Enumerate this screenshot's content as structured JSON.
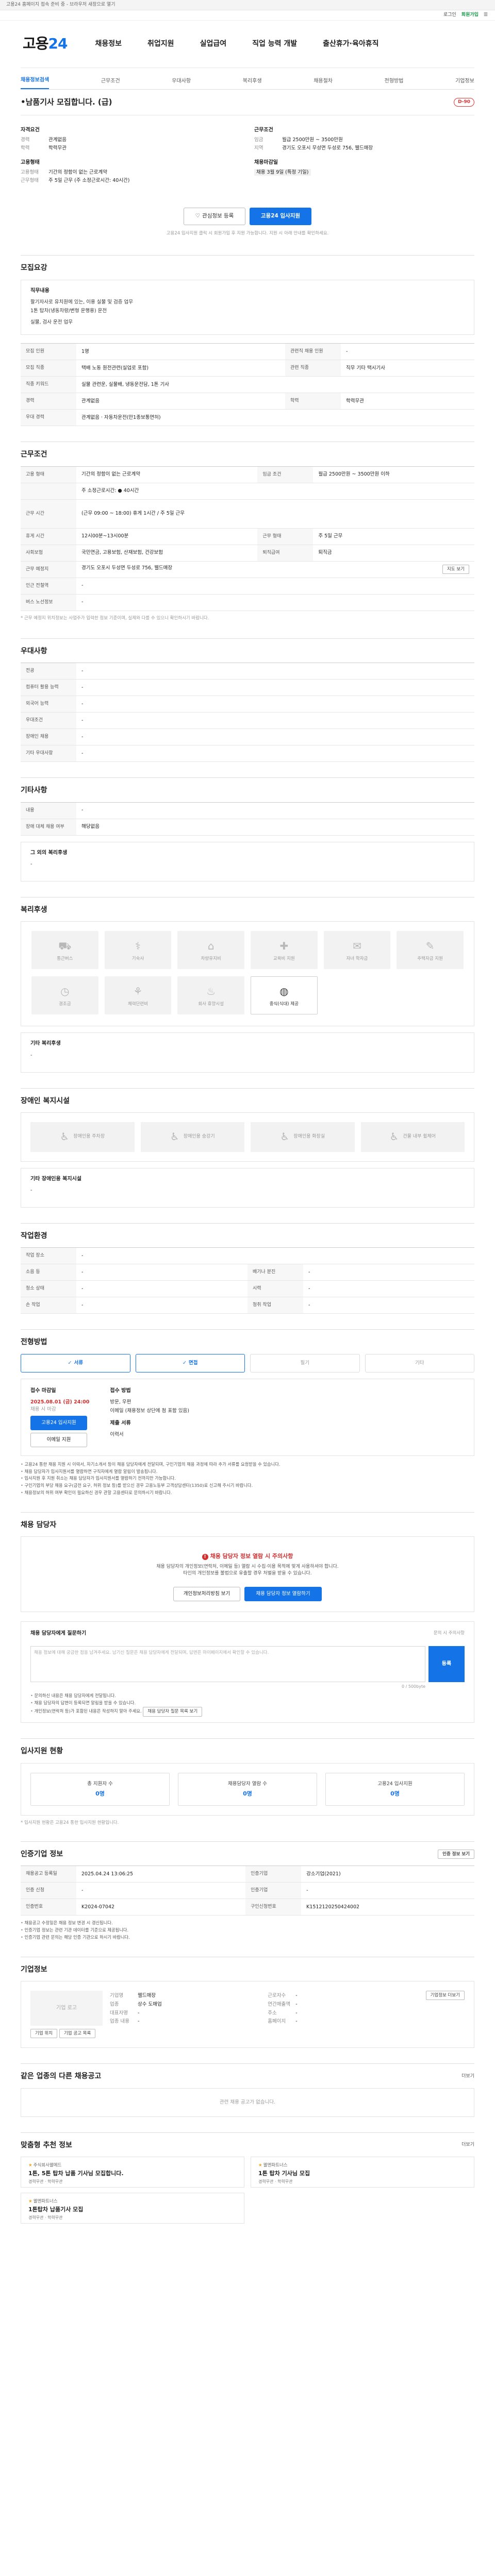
{
  "banner": {
    "text": "고용24 홈페이지 접속 준비 중 - 브라우저 새창으로 열기"
  },
  "util": {
    "login": "로그인",
    "join": "회원가입",
    "menu": "전체메뉴"
  },
  "header": {
    "logo_main": "고용",
    "logo_num": "24",
    "gnb": [
      "채용정보",
      "취업지원",
      "실업급여",
      "직업 능력 개발",
      "출산휴가·육아휴직"
    ]
  },
  "subtabs": [
    "채용정보검색",
    "근무조건",
    "우대사항",
    "복리후생",
    "채용절차",
    "전형방법",
    "기업정보"
  ],
  "job": {
    "title": "•남품기사 모집합니다. (급)",
    "dday": "D-90"
  },
  "summary": {
    "left_label": "자격요건",
    "left_rows": [
      {
        "k": "경력",
        "v": "관계없음"
      },
      {
        "k": "학력",
        "v": "학력무관"
      }
    ],
    "left_label2": "고용형태",
    "left_rows2": [
      {
        "k": "고용형태",
        "v": "기간의 정함이 없는 근로계약"
      },
      {
        "k": "근무형태",
        "v": "주 5일 근무 (주 소정근로시간: 40시간)"
      }
    ],
    "right_label": "근무조건",
    "right_rows": [
      {
        "k": "임금",
        "v": "월급 2500만원 ~ 3500만원"
      },
      {
        "k": "지역",
        "v": "경기도 오포시 무성면 두성로 756, 웰드매장"
      }
    ],
    "right_label2": "채용마감일",
    "right_rows2": [
      {
        "k": "",
        "v": "채용 3월 9일 (특정 기일)"
      }
    ]
  },
  "actions": {
    "scrap": "관심정보 등록",
    "apply": "고용24 입사지원"
  },
  "apply_note": "고용24 입사지원 클릭 시 회원가입 후 지원 가능합니다. 지원 시 아래 안내를 확인하세요.",
  "recruit": {
    "heading": "모집요강",
    "duty_label": "직무내용",
    "duty_lines": [
      "팔기자사로 유치원에 있는, 이용 실물 및 검증 업무",
      "1톤 탑차(냉동차량/변형 운행용) 운전",
      "실물, 검사 운전 업무"
    ],
    "rows": [
      {
        "k": "모집 인원",
        "v": "1명",
        "k2": "관련직 채용 인원",
        "v2": "-"
      },
      {
        "k": "모집 직종",
        "v": "택배 노동 원전관련(실업로 포함)",
        "k2": "관련 직종",
        "v2": "직무 기타 택시기사"
      },
      {
        "k": "직종 키워드",
        "v": "실물 관련운, 실물배, 냉동운전담, 1톤 기사",
        "k2": "",
        "v2": ""
      },
      {
        "k": "경력",
        "v": "관계없음",
        "k2": "학력",
        "v2": "학력무관"
      },
      {
        "k": "우대 경력",
        "v": "관계없음 · 자동차운전(만1종보통면허)",
        "k2": "",
        "v2": ""
      }
    ]
  },
  "conditions": {
    "heading": "근무조건",
    "rows": [
      {
        "k": "고용 형태",
        "v": "기간의 정함이 없는 근로계약",
        "k2": "임금 조건",
        "v2": "월급 2500만원 ~ 3500만원 이하"
      },
      {
        "k": "",
        "v": "주 소정근로시간: ● 40시간",
        "k2": "",
        "v2": ""
      },
      {
        "k": "근무 시간",
        "v": "(근무 09:00 ~ 18:00) 휴게 1시간 / 주 5일 근무",
        "k2": "",
        "v2": ""
      },
      {
        "k": "휴게 시간",
        "v": "12시00분~13시00분",
        "k2": "근무 형태",
        "v2": "주 5일 근무"
      },
      {
        "k": "사회보험",
        "v": "국민연금, 고용보험, 산재보험, 건강보험",
        "k2": "퇴직급여",
        "v2": "퇴직금"
      },
      {
        "k": "근무 예정지",
        "v": "경기도 오포시 두성면 두성로 756, 웰드매장",
        "k2": "",
        "v2": ""
      },
      {
        "k": "인근 전철역",
        "v": "-",
        "k2": "",
        "v2": ""
      },
      {
        "k": "버스 노선정보",
        "v": "-",
        "k2": "",
        "v2": ""
      }
    ],
    "note": "* 근무 예정지 위치정보는 사업주가 입력한 정보 기준이며, 실제와 다를 수 있으니 확인하시기 바랍니다.",
    "map_btn": "지도 보기"
  },
  "preferred": {
    "heading": "우대사항",
    "rows": [
      {
        "k": "전공",
        "v": "-"
      },
      {
        "k": "컴퓨터 활용 능력",
        "v": "-"
      },
      {
        "k": "외국어 능력",
        "v": "-"
      },
      {
        "k": "우대조건",
        "v": "-"
      },
      {
        "k": "장애인 채용",
        "v": "-"
      },
      {
        "k": "기타 우대사항",
        "v": "-"
      }
    ]
  },
  "other": {
    "heading": "기타사항",
    "rows": [
      {
        "k": "내용",
        "v": "-"
      },
      {
        "k": "장애 대체 채용 여부",
        "v": "해당없음"
      }
    ],
    "sub_label": "그 외의 복리후생",
    "sub_value": "-"
  },
  "welfare": {
    "heading": "복리후생",
    "items": [
      {
        "icon": "car-icon",
        "glyph": "⛟",
        "label": "통근버스",
        "on": false
      },
      {
        "icon": "meal-icon",
        "glyph": "⚕",
        "label": "기숙사",
        "on": false
      },
      {
        "icon": "house-icon",
        "glyph": "⌂",
        "label": "차량유지비",
        "on": false
      },
      {
        "icon": "health-icon",
        "glyph": "✚",
        "label": "교육비 지원",
        "on": false
      },
      {
        "icon": "gift-icon",
        "glyph": "✉",
        "label": "자녀 학자금",
        "on": false
      },
      {
        "icon": "grad-icon",
        "glyph": "✎",
        "label": "주택자금 지원",
        "on": false
      },
      {
        "icon": "clock-icon",
        "glyph": "◷",
        "label": "경조금",
        "on": false
      },
      {
        "icon": "leaf-icon",
        "glyph": "⚘",
        "label": "체력단련비",
        "on": false
      },
      {
        "icon": "lodge-icon",
        "glyph": "♨",
        "label": "회사 휴양시설",
        "on": false
      },
      {
        "icon": "meal-provided-icon",
        "glyph": "◍",
        "label": "중식(식대) 제공",
        "on": true
      }
    ],
    "sub_label": "기타 복리후생",
    "sub_value": "-"
  },
  "disabled": {
    "heading": "장애인 복지시설",
    "items": [
      {
        "icon": "ramp-icon",
        "glyph": "♿",
        "label": "장애인용 주차장"
      },
      {
        "icon": "toilet-icon",
        "glyph": "♿",
        "label": "장애인용 승강기"
      },
      {
        "icon": "elevator-icon",
        "glyph": "♿",
        "label": "장애인용 화장실"
      },
      {
        "icon": "lift-icon",
        "glyph": "♿",
        "label": "건물 내부 휠체어"
      }
    ],
    "sub_label": "기타 장애인용 복지시설",
    "sub_value": "-"
  },
  "env": {
    "heading": "작업환경",
    "rows": [
      {
        "k": "작업 장소",
        "v": "-",
        "k2": "",
        "v2": ""
      },
      {
        "k": "소음 등",
        "v": "-",
        "k2": "배기나 분진",
        "v2": "-"
      },
      {
        "k": "청소 상태",
        "v": "-",
        "k2": "시력",
        "v2": "-"
      },
      {
        "k": "손 작업",
        "v": "-",
        "k2": "청취 작업",
        "v2": "-"
      }
    ]
  },
  "process": {
    "heading": "전형방법",
    "steps": [
      {
        "label": "서류",
        "on": true
      },
      {
        "label": "면접",
        "on": true
      },
      {
        "label": "필기",
        "on": false
      },
      {
        "label": "기타",
        "on": false
      }
    ],
    "deadline_label": "접수 마감일",
    "deadline_value": "2025.08.01 (금) 24:00",
    "deadline_sub": "채용 시 마감",
    "method_label": "접수 방법",
    "method_lines": [
      "방문, 우편",
      "이메일 (채용정보 상단에 첨 표함 있음)"
    ],
    "docs_label": "제출 서류",
    "docs_value": "이력서",
    "btn_apply": "고용24 입사지원",
    "btn_visit": "이메일 지원",
    "bullets": [
      "고용24 통한 채용 지원 시 이력서, 자기소개서 등이 채용 담당자에게 전달되며, 구인기업의 채용 과정에 따라 추가 서류를 요청받을 수 있습니다.",
      "채용 담당자가 입사지원서를 열람하면 구직자에게 열람 알림이 발송됩니다.",
      "입사지원 후 지원 취소는 채용 담당자가 입사지원서를 열람하기 전까지만 가능합니다.",
      "구인기업의 부당 채용 요구(금전 요구, 허위 정보 등)를 받으신 경우 고용노동부 고객상담센터(1350)로 신고해 주시기 바랍니다.",
      "채용정보의 허위 여부 확인이 필요하신 경우 관할 고용센터로 문의하시기 바랍니다."
    ]
  },
  "talent": {
    "heading": "채용 담당자",
    "warn": "채용 담당자 정보 열람 시 주의사항",
    "line1": "채용 담당자의 개인정보(연락처, 이메일 등) 열람 시 수집·이용 목적에 맞게 사용하셔야 합니다.",
    "line2": "타인의 개인정보를 불법으로 유출할 경우 처벌을 받을 수 있습니다.",
    "btn_left": "개인정보처리방침 보기",
    "btn_right": "채용 담당자 정보 열람하기"
  },
  "question": {
    "heading": "채용 담당자에게 질문하기",
    "side": "문의 시 주의사항",
    "placeholder": "채용 정보에 대해 궁금한 점을 남겨주세요. 남기신 질문은 채용 담당자에게 전달되며, 답변은 마이페이지에서 확인할 수 있습니다.",
    "count": "0 / 500byte",
    "submit": "등록",
    "bullets": [
      "문의하신 내용은 채용 담당자에게 전달됩니다.",
      "채용 담당자의 답변이 등록되면 알림을 받을 수 있습니다.",
      "개인정보(연락처 등)가 포함된 내용은 작성하지 말아 주세요."
    ],
    "more": "채용 담당자 질문 목록 보기"
  },
  "status": {
    "heading": "입사지원 현황",
    "cards": [
      {
        "label": "총 지원자 수",
        "value": "0명"
      },
      {
        "label": "채용담당자 열람 수",
        "value": "0명"
      },
      {
        "label": "고용24 입사지원",
        "value": "0명"
      }
    ],
    "note": "* 입사지원 현황은 고용24 통한 입사지원 현황입니다."
  },
  "reginfo": {
    "heading": "인증기업 정보",
    "more": "인증 정보 보기",
    "rows": [
      {
        "k": "채용공고 등록일",
        "v": "2025.04.24 13:06:25",
        "k2": "인증기업",
        "v2": "강소기업(2021)"
      },
      {
        "k": "인증 신청",
        "v": "-",
        "k2": "인증기업",
        "v2": "-"
      },
      {
        "k": "인증번호",
        "v": "K2024-07042",
        "k2": "구인신청번호",
        "v2": "K1512120250424002"
      }
    ],
    "bullets": [
      "채용공고 수정일은 채용 정보 변경 시 갱신됩니다.",
      "인증기업 정보는 관련 기관 데이터를 기준으로 제공됩니다.",
      "인증기업 관련 문의는 해당 인증 기관으로 하시기 바랍니다."
    ]
  },
  "company": {
    "heading": "기업정보",
    "logo_alt": "기업 로고",
    "rows": [
      {
        "k": "기업명",
        "v": "웰드매장"
      },
      {
        "k": "업종",
        "v": "상수 도매업"
      },
      {
        "k": "대표자명",
        "v": "-"
      },
      {
        "k": "업종 내용",
        "v": "-"
      }
    ],
    "rows2": [
      {
        "k": "근로자수",
        "v": "-"
      },
      {
        "k": "연간매출액",
        "v": "-"
      },
      {
        "k": "주소",
        "v": "-"
      },
      {
        "k": "홈페이지",
        "v": "-"
      }
    ],
    "more": "기업정보 더보기",
    "tags": [
      "기업 위치",
      "기업 공고 목록"
    ]
  },
  "samejob": {
    "heading": "같은 업종의 다른 채용공고",
    "more": "더보기",
    "empty": "관련 채용 공고가 없습니다."
  },
  "recommend": {
    "heading": "맞춤형 추천 정보",
    "more": "더보기",
    "items": [
      {
        "company": "주식회사웰메드",
        "title": "1톤, 5톤 탑차 납품 기사님 모집합니다.",
        "meta": "경력무관 · 학력무관"
      },
      {
        "company": "웰엔파트너스",
        "title": "1톤 탑차 기사님 모집",
        "meta": "경력무관 · 학력무관"
      },
      {
        "company": "웰엔파트너스",
        "title": "1톤탑차 납품기사 모집",
        "meta": "경력무관 · 학력무관"
      }
    ]
  }
}
